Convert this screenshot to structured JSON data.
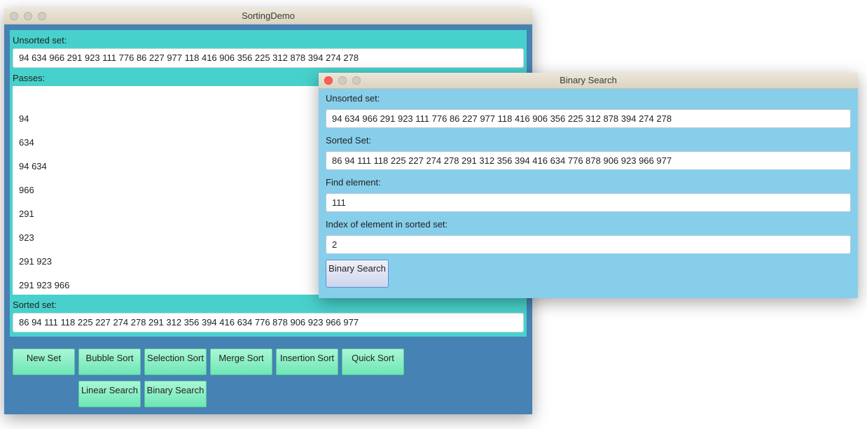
{
  "main": {
    "title": "SortingDemo",
    "unsorted_label": "Unsorted set:",
    "unsorted_value": "94  634  966  291  923  111  776  86  227  977  118  416  906  356  225  312  878  394  274  278",
    "passes_label": "Passes:",
    "passes": [
      "94",
      "634",
      "94  634",
      "966",
      "291",
      "923",
      "291  923",
      "291  923  966"
    ],
    "sorted_label": "Sorted set:",
    "sorted_value": "86  94  111  118  225  227  274  278  291  312  356  394  416  634  776  878  906  923  966  977",
    "buttons": {
      "new_set": "New Set",
      "bubble_sort": "Bubble Sort",
      "selection_sort": "Selection Sort",
      "merge_sort": "Merge Sort",
      "insertion_sort": "Insertion Sort",
      "quick_sort": "Quick Sort",
      "linear_search": "Linear Search",
      "binary_search": "Binary Search"
    }
  },
  "binary_search_window": {
    "title": "Binary Search",
    "unsorted_label": "Unsorted set:",
    "unsorted_value": "94  634  966  291  923  111  776  86  227  977  118  416  906  356  225  312  878  394  274  278",
    "sorted_label": "Sorted Set:",
    "sorted_value": "86  94  111  118  225  227  274  278  291  312  356  394  416  634  776  878  906  923  966  977",
    "find_label": "Find element:",
    "find_value": "111",
    "index_label": "Index of element in sorted set:",
    "index_value": "2",
    "button_label": "Binary Search"
  },
  "colors": {
    "main_bg": "#4682b4",
    "panel_bg": "#48d1cc",
    "dialog_bg": "#87ceeb",
    "button_green": "#7ff0c0"
  }
}
